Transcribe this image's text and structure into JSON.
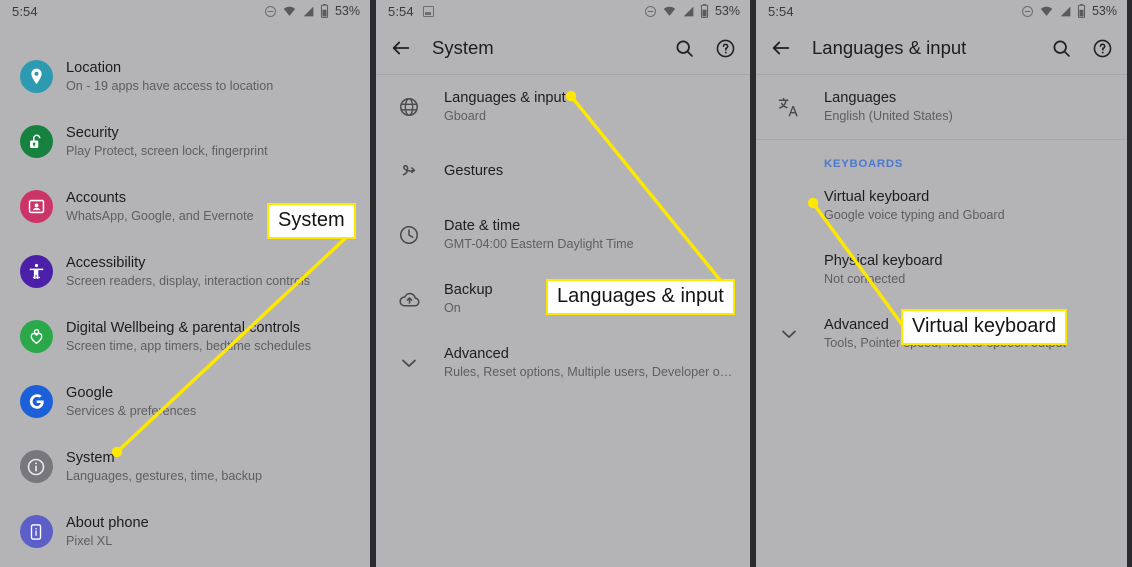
{
  "status_bar": {
    "time": "5:54",
    "battery": "53%",
    "icons": [
      "do-not-disturb-icon",
      "wifi-icon",
      "cell-signal-icon",
      "battery-icon"
    ]
  },
  "colors": {
    "screen_bg": "#b4b4b6",
    "divider": "#2b2b2f",
    "callout_border": "#ffe800",
    "section_label": "#4c78d0",
    "location_icon": "#2c9ab0",
    "security_icon": "#17823f",
    "accounts_icon": "#cc3366",
    "accessibility_icon": "#4b1fa8",
    "wellbeing_icon": "#2aa84a",
    "google_icon": "#1b5fd9",
    "system_icon": "#78787c",
    "about_icon": "#5c5fc8"
  },
  "panel1": {
    "name": "Settings list",
    "items": [
      {
        "title": "Location",
        "subtitle": "On - 19 apps have access to location",
        "icon": "location-pin-icon",
        "icon_name": "location"
      },
      {
        "title": "Security",
        "subtitle": "Play Protect, screen lock, fingerprint",
        "icon": "unlocked-padlock-icon",
        "icon_name": "security"
      },
      {
        "title": "Accounts",
        "subtitle": "WhatsApp, Google, and Evernote",
        "icon": "account-card-icon",
        "icon_name": "accounts"
      },
      {
        "title": "Accessibility",
        "subtitle": "Screen readers, display, interaction controls",
        "icon": "accessibility-person-icon",
        "icon_name": "accessibility"
      },
      {
        "title": "Digital Wellbeing & parental controls",
        "subtitle": "Screen time, app timers, bedtime schedules",
        "icon": "heart-person-icon",
        "icon_name": "wellbeing"
      },
      {
        "title": "Google",
        "subtitle": "Services & preferences",
        "icon": "google-g-icon",
        "icon_name": "google"
      },
      {
        "title": "System",
        "subtitle": "Languages, gestures, time, backup",
        "icon": "info-circle-icon",
        "icon_name": "system"
      },
      {
        "title": "About phone",
        "subtitle": "Pixel XL",
        "icon": "phone-info-icon",
        "icon_name": "about"
      }
    ]
  },
  "panel2": {
    "appbar": {
      "back": "back-arrow-icon",
      "title": "System",
      "search": "search-icon",
      "help": "help-circle-icon"
    },
    "items": [
      {
        "title": "Languages & input",
        "subtitle": "Gboard",
        "icon": "globe-icon"
      },
      {
        "title": "Gestures",
        "subtitle": "",
        "icon": "gesture-swirl-icon"
      },
      {
        "title": "Date & time",
        "subtitle": "GMT-04:00 Eastern Daylight Time",
        "icon": "clock-icon"
      },
      {
        "title": "Backup",
        "subtitle": "On",
        "icon": "cloud-upload-icon"
      },
      {
        "title": "Advanced",
        "subtitle": "Rules, Reset options, Multiple users, Developer opti...",
        "icon": "chevron-down-icon"
      }
    ]
  },
  "panel3": {
    "appbar": {
      "back": "back-arrow-icon",
      "title": "Languages & input",
      "search": "search-icon",
      "help": "help-circle-icon"
    },
    "items_top": [
      {
        "title": "Languages",
        "subtitle": "English (United States)",
        "icon": "translate-icon"
      }
    ],
    "section_label": "KEYBOARDS",
    "items": [
      {
        "title": "Virtual keyboard",
        "subtitle": "Google voice typing and Gboard",
        "icon": ""
      },
      {
        "title": "Physical keyboard",
        "subtitle": "Not connected",
        "icon": ""
      },
      {
        "title": "Advanced",
        "subtitle": "Tools, Pointer speed, Text-to-speech output",
        "icon": "chevron-down-icon"
      }
    ]
  },
  "callouts": [
    {
      "label": "System"
    },
    {
      "label": "Languages & input"
    },
    {
      "label": "Virtual keyboard"
    }
  ]
}
